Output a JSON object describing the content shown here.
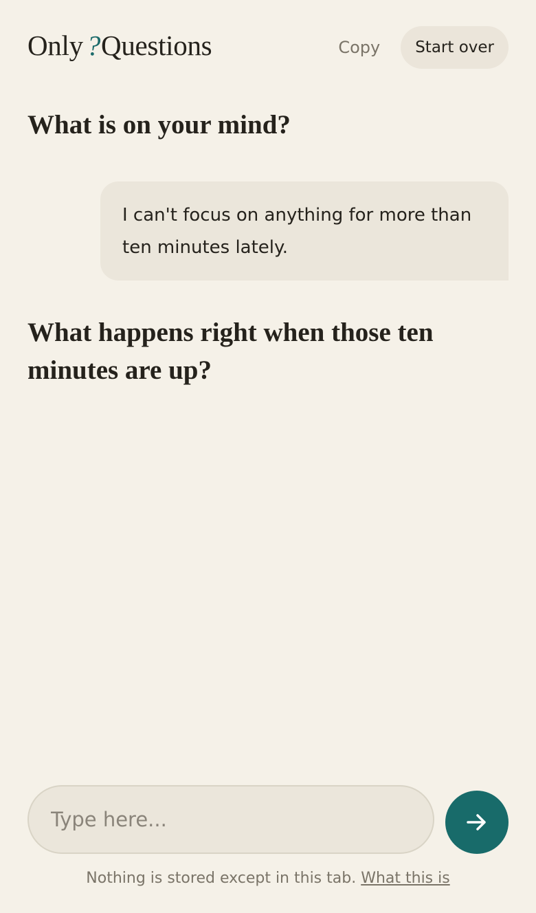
{
  "header": {
    "logo_left": "Only",
    "logo_mark": "?",
    "logo_right": "Questions",
    "copy_label": "Copy",
    "start_over_label": "Start over"
  },
  "conversation": {
    "question_1": "What is on your mind?",
    "user_message": "I can't focus on anything for more than ten minutes lately.",
    "question_2": "What happens right when those ten minutes are up?"
  },
  "composer": {
    "placeholder": "Type here...",
    "value": "",
    "send_icon": "arrow-right-icon"
  },
  "footer": {
    "notice": "Nothing is stored except in this tab.",
    "link_label": "What this is"
  },
  "colors": {
    "background": "#f5f1e8",
    "accent": "#186b6a",
    "bubble": "#ebe6db",
    "muted_text": "#7a7468"
  }
}
